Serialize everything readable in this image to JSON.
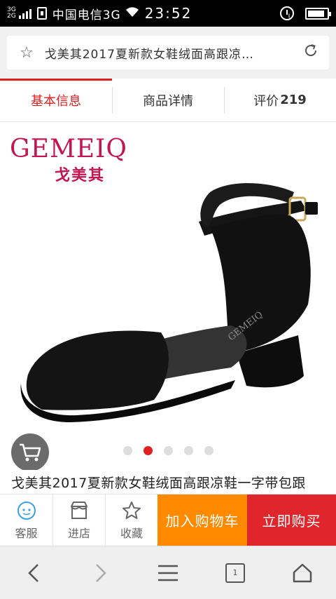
{
  "status_bar": {
    "network_top": "3G",
    "network_bottom": "2G",
    "carrier": "中国电信3G",
    "time": "23:52",
    "battery_level": 0.9
  },
  "address_bar": {
    "title": "戈美其2017夏新款女鞋绒面高跟凉…"
  },
  "tabs": [
    {
      "label": "基本信息",
      "count": ""
    },
    {
      "label": "商品详情",
      "count": ""
    },
    {
      "label": "评价",
      "count": "219"
    }
  ],
  "product": {
    "brand_en": "GEMEIQ",
    "brand_cn": "戈美其",
    "carousel_total": 5,
    "carousel_active": 2,
    "title": "戈美其2017夏新款女鞋绒面高跟凉鞋一字带包跟"
  },
  "actions": {
    "service_label": "客服",
    "store_label": "进店",
    "favorite_label": "收藏",
    "add_cart_label": "加入购物车",
    "buy_now_label": "立即购买"
  },
  "browser_nav": {
    "tab_count": "1"
  },
  "colors": {
    "accent_red": "#e02020",
    "cart_orange": "#ff8a00",
    "buy_red": "#e0262d",
    "brand_pink": "#c3164f"
  }
}
